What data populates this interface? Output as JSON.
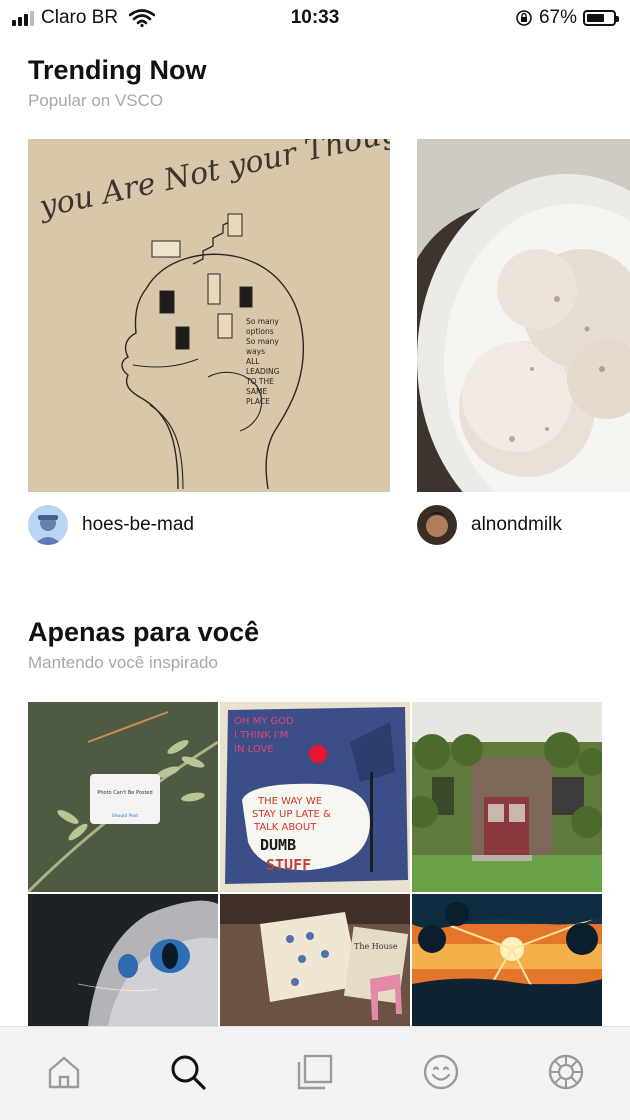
{
  "status_bar": {
    "carrier": "Claro BR",
    "time": "10:33",
    "battery": "67%",
    "battery_level": 0.67
  },
  "trending": {
    "title": "Trending Now",
    "subtitle": "Popular on VSCO",
    "items": [
      {
        "username": "hoes-be-mad",
        "image_text": [
          "you Are Not your Thoughts"
        ],
        "image_notes": [
          "So many",
          "options",
          "So many",
          "ways",
          "ALL",
          "LEADING",
          "TO THE",
          "SAME",
          "PLACE"
        ]
      },
      {
        "username": "alnondmilk"
      }
    ]
  },
  "for_you": {
    "title": "Apenas para você",
    "subtitle": "Mantendo você inspirado",
    "tiles": [
      {
        "desc": "plant",
        "notice_title": "Photo Can't Be Posted",
        "notice_button": "Should Post"
      },
      {
        "desc": "dumb stuff collage",
        "lines": [
          "OH MY GOD",
          "I THINK I'M",
          "IN LOVE",
          "THE WAY WE",
          "STAY UP LATE &",
          "TALK ABOUT",
          "DUMB",
          "STUFF"
        ]
      },
      {
        "desc": "ivy building"
      },
      {
        "desc": "cat eye"
      },
      {
        "desc": "desk",
        "book": "The House"
      },
      {
        "desc": "sunset"
      }
    ]
  },
  "nav": {
    "items": [
      "home-icon",
      "search-icon",
      "studio-icon",
      "profile-icon",
      "settings-icon"
    ],
    "active": "search-icon"
  }
}
